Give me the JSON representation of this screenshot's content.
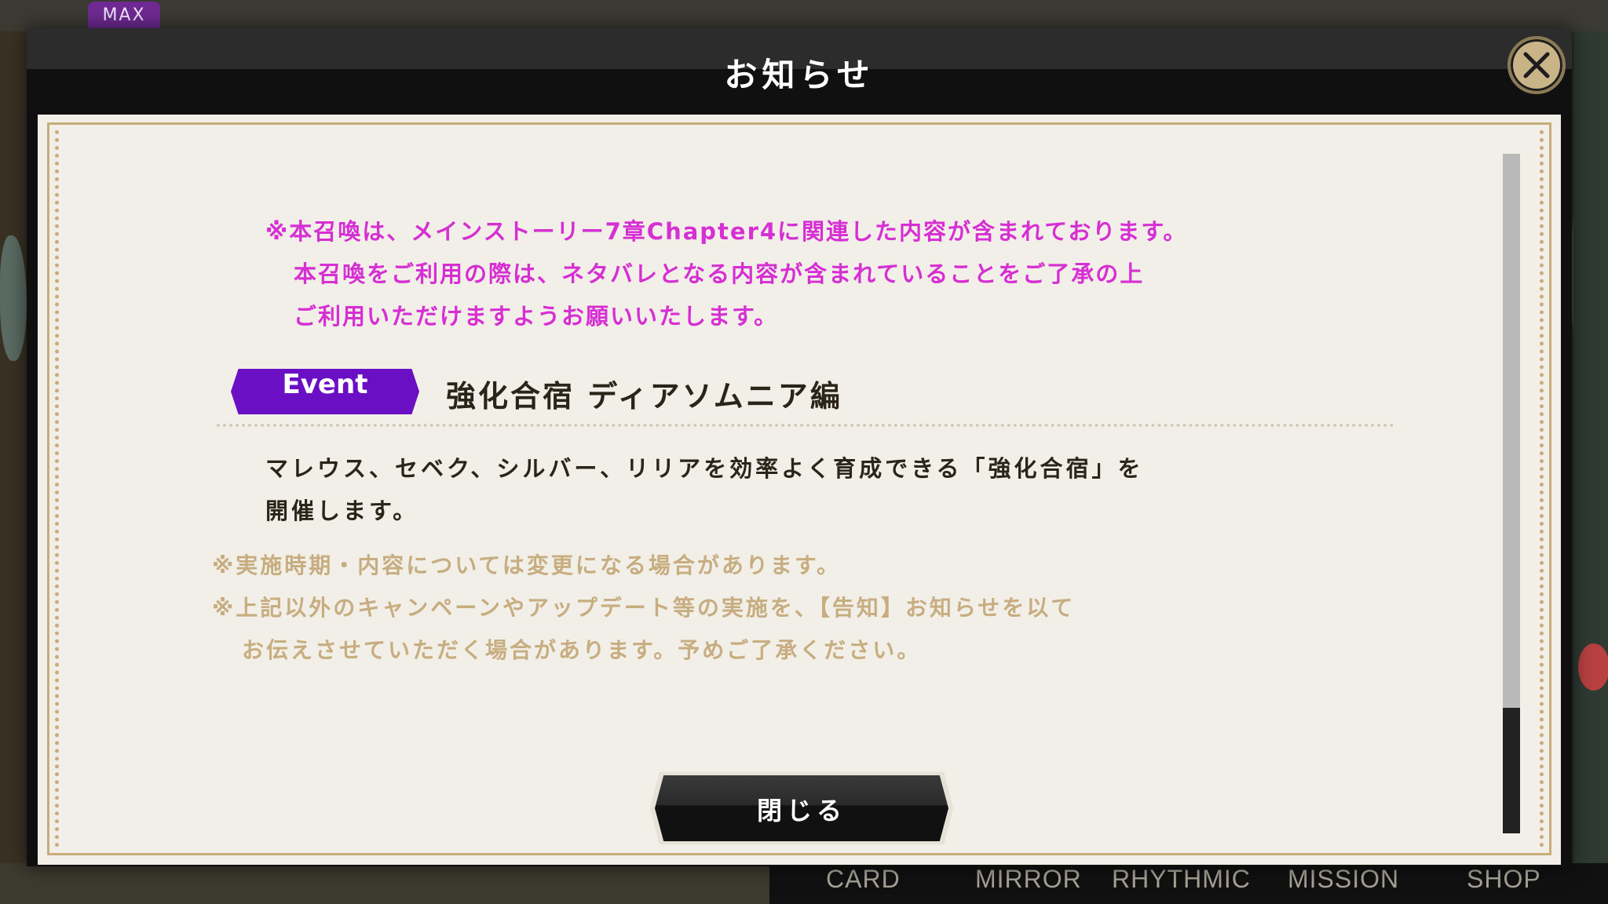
{
  "hud": {
    "max_badge": "MAX"
  },
  "dialog": {
    "title": "お知らせ",
    "spoiler_notice": [
      "※本召喚は、メインストーリー7章Chapter4に関連した内容が含まれております。",
      "本召喚をご利用の際は、ネタバレとなる内容が含まれていることをご了承の上",
      "ご利用いただけますようお願いいたします。"
    ],
    "event_tag": "Event",
    "event_title": "強化合宿 ディアソムニア編",
    "description": [
      "マレウス、セベク、シルバー、リリアを効率よく育成できる「強化合宿」を",
      "開催します。"
    ],
    "footnotes": [
      "※実施時期・内容については変更になる場合があります。",
      "※上記以外のキャンペーンやアップデート等の実施を、【告知】お知らせを以て",
      "お伝えさせていただく場合があります。予めご了承ください。"
    ],
    "close_button_label": "閉じる",
    "close_icon": "close-icon"
  },
  "bottom_nav": {
    "items": [
      "CARD",
      "MIRROR",
      "RHYTHMIC",
      "MISSION",
      "SHOP"
    ]
  },
  "colors": {
    "spoiler_text": "#d62fd3",
    "event_tag": "#6b0fc4",
    "frame_gold": "#c7ad7a",
    "footnote_text": "#c7ad80"
  }
}
